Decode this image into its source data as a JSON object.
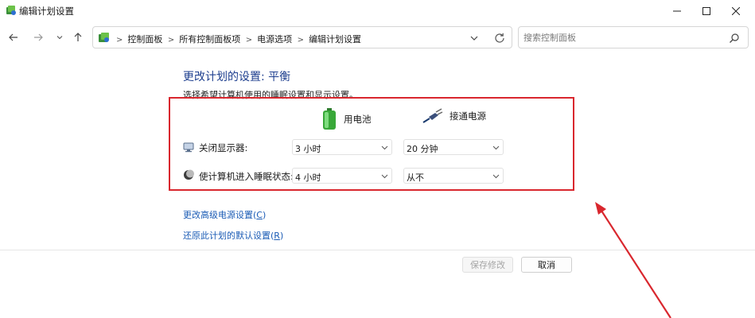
{
  "window": {
    "title": "编辑计划设置"
  },
  "address": {
    "breadcrumbs": [
      "控制面板",
      "所有控制面板项",
      "电源选项",
      "编辑计划设置"
    ]
  },
  "search": {
    "placeholder": "搜索控制面板"
  },
  "plan": {
    "title": "更改计划的设置: 平衡",
    "subtitle": "选择希望计算机使用的睡眠设置和显示设置。"
  },
  "columns": {
    "battery": "用电池",
    "plugged": "接通电源"
  },
  "settings": [
    {
      "label": "关闭显示器:",
      "icon": "monitor-icon",
      "battery": "3 小时",
      "plugged": "20 分钟"
    },
    {
      "label": "使计算机进入睡眠状态:",
      "icon": "sleep-moon-icon",
      "battery": "4 小时",
      "plugged": "从不"
    }
  ],
  "links": {
    "advanced": {
      "text": "更改高级电源设置(",
      "key": "C",
      "end": ")"
    },
    "restore": {
      "text": "还原此计划的默认设置(",
      "key": "R",
      "end": ")"
    }
  },
  "buttons": {
    "save": "保存修改",
    "cancel": "取消"
  },
  "colors": {
    "title_blue": "#1e3f8f",
    "link_blue": "#1a5bb5",
    "annotation_red": "#d9272e"
  }
}
